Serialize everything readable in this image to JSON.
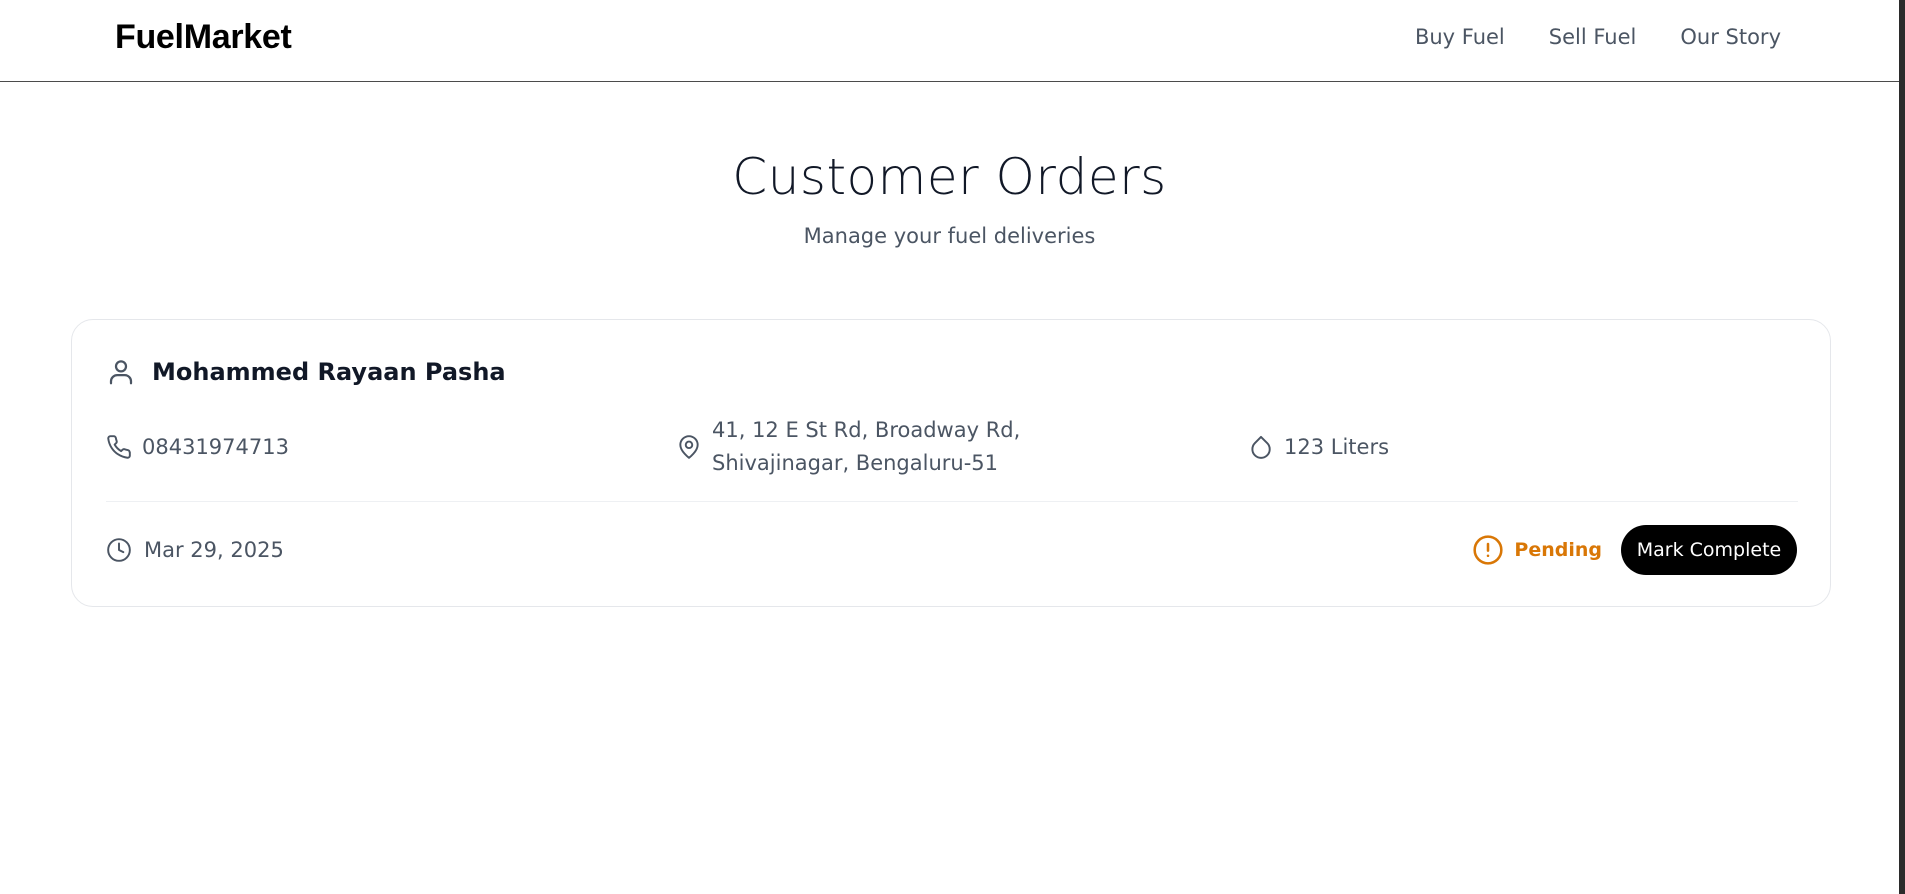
{
  "brand": {
    "name": "FuelMarket"
  },
  "nav": {
    "links": [
      "Buy Fuel",
      "Sell Fuel",
      "Our Story"
    ]
  },
  "header": {
    "title": "Customer Orders",
    "subtitle": "Manage your fuel deliveries"
  },
  "order": {
    "customer_name": "Mohammed Rayaan Pasha",
    "phone": "08431974713",
    "address": "41, 12 E St Rd, Broadway Rd, Shivajinagar, Bengaluru-51",
    "quantity": "123 Liters",
    "date": "Mar 29, 2025",
    "status": "Pending",
    "action_label": "Mark Complete",
    "icons": {
      "customer": "user-icon",
      "phone": "phone-icon",
      "address": "map-pin-icon",
      "quantity": "droplet-icon",
      "date": "clock-icon",
      "status": "alert-circle-icon"
    }
  },
  "colors": {
    "status_pending": "#d97706",
    "button_bg": "#000000",
    "muted_text": "#4b5563"
  }
}
